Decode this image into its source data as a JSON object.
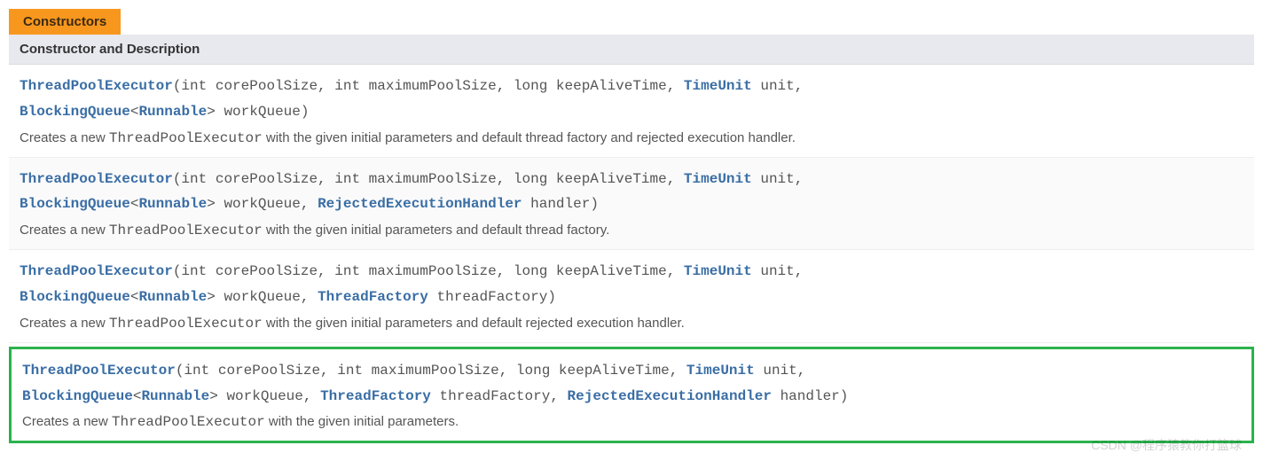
{
  "tab_label": "Constructors",
  "header_label": "Constructor and Description",
  "type_name": "ThreadPoolExecutor",
  "types": {
    "TimeUnit": "TimeUnit",
    "BlockingQueue": "BlockingQueue",
    "Runnable": "Runnable",
    "ThreadFactory": "ThreadFactory",
    "RejectedExecutionHandler": "RejectedExecutionHandler"
  },
  "rows": [
    {
      "sig": {
        "name": "ThreadPoolExecutor",
        "open": "(int corePoolSize, int maximumPoolSize, long keepAliveTime, ",
        "unit_suffix": " unit,",
        "queue_open": "<",
        "queue_close": "> workQueue)",
        "extra": ""
      },
      "desc_pre": "Creates a new ",
      "desc_code": "ThreadPoolExecutor",
      "desc_post": " with the given initial parameters and default thread factory and rejected execution handler."
    },
    {
      "sig": {
        "name": "ThreadPoolExecutor",
        "open": "(int corePoolSize, int maximumPoolSize, long keepAliveTime, ",
        "unit_suffix": " unit,",
        "queue_open": "<",
        "queue_close": "> workQueue, ",
        "extra_handler_suffix": " handler)"
      },
      "desc_pre": "Creates a new ",
      "desc_code": "ThreadPoolExecutor",
      "desc_post": " with the given initial parameters and default thread factory."
    },
    {
      "sig": {
        "name": "ThreadPoolExecutor",
        "open": "(int corePoolSize, int maximumPoolSize, long keepAliveTime, ",
        "unit_suffix": " unit,",
        "queue_open": "<",
        "queue_close": "> workQueue, ",
        "extra_factory_suffix": " threadFactory)"
      },
      "desc_pre": "Creates a new ",
      "desc_code": "ThreadPoolExecutor",
      "desc_post": " with the given initial parameters and default rejected execution handler."
    },
    {
      "sig": {
        "name": "ThreadPoolExecutor",
        "open": "(int corePoolSize, int maximumPoolSize, long keepAliveTime, ",
        "unit_suffix": " unit,",
        "queue_open": "<",
        "queue_close": "> workQueue, ",
        "extra_factory_mid": " threadFactory, ",
        "extra_handler_suffix": " handler)"
      },
      "desc_pre": "Creates a new ",
      "desc_code": "ThreadPoolExecutor",
      "desc_post": " with the given initial parameters."
    }
  ],
  "watermark": "CSDN @程序猿教你打篮球"
}
